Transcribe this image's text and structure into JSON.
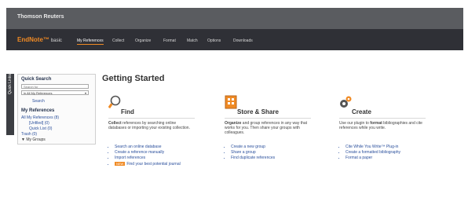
{
  "header": {
    "brand": "Thomson Reuters"
  },
  "nav": {
    "logo": "EndNote™",
    "logo_sub": "basic",
    "tabs": [
      "My References",
      "Collect",
      "Organize",
      "Format",
      "Match",
      "Options",
      "Downloads"
    ],
    "active_tab": "My References"
  },
  "side_tab": "Quick Links",
  "sidebar": {
    "quick_search_title": "Quick Search",
    "search_for_placeholder": "Search for",
    "in_value": "in  All My References",
    "search_button": "Search",
    "my_refs_title": "My References",
    "all_refs": "All My References (8)",
    "unfiled": "[Unfiled] (0)",
    "quick_list": "Quick List (0)",
    "trash": "Trash (0)",
    "my_groups": "My Groups"
  },
  "main": {
    "title": "Getting Started",
    "columns": [
      {
        "name": "Find",
        "desc_bold": "Collect",
        "desc": " references by searching online databases or importing your existing collection.",
        "links": [
          "Search an online database",
          "Create a reference manually",
          "Import references"
        ],
        "extra_badge": "NEW",
        "extra": "Find your best potential journal"
      },
      {
        "name": "Store & Share",
        "desc_bold": "Organize",
        "desc": " and group references in any way that works for you. Then share your groups with colleagues.",
        "links": [
          "Create a new group",
          "Share a group",
          "Find duplicate references"
        ]
      },
      {
        "name": "Create",
        "desc_pre": "Use our plugin to ",
        "desc_bold": "format",
        "desc": " bibliographies and cite references while you write.",
        "links": [
          "Cite While You Write™ Plug-in",
          "Create a formatted bibliography",
          "Format a paper"
        ]
      }
    ]
  }
}
